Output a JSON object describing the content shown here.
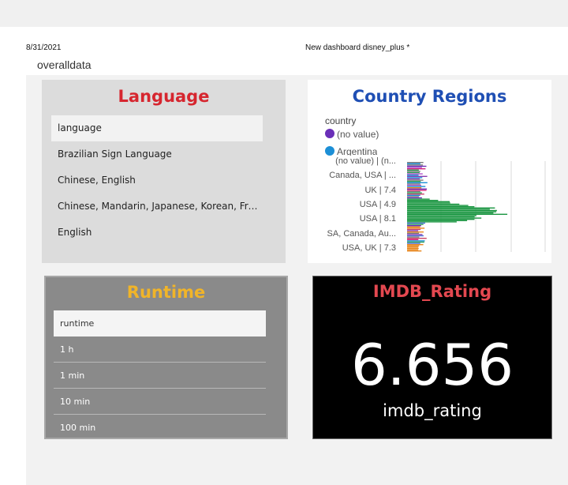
{
  "header": {
    "date": "8/31/2021",
    "dashboard_title": "New dashboard disney_plus *"
  },
  "sheet": {
    "name": "overalldata"
  },
  "colors": {
    "language_title": "#d6262f",
    "country_title": "#1f4fb4",
    "runtime_title": "#f0b429",
    "imdb_title": "#e34850",
    "bar_green": "#1a9641",
    "bar_orange": "#e8871e"
  },
  "language": {
    "title": "Language",
    "header": "language",
    "items": [
      "Brazilian Sign Language",
      "Chinese, English",
      "Chinese, Mandarin, Japanese, Korean, Fren...",
      "English"
    ]
  },
  "country": {
    "title": "Country Regions",
    "legend_title": "country",
    "legend": [
      {
        "label": "(no value)",
        "color": "#6a2fb8"
      },
      {
        "label": "Argentina",
        "color": "#1c8fd6"
      }
    ],
    "y_labels": [
      "(no value) | (n...",
      "Canada, USA | ...",
      "UK | 7.4",
      "USA | 4.9",
      "USA | 8.1",
      "SA, Canada, Au...",
      "USA, UK | 7.3"
    ]
  },
  "runtime": {
    "title": "Runtime",
    "header": "runtime",
    "items": [
      "1 h",
      "1 min",
      "10 min",
      "100 min"
    ]
  },
  "imdb": {
    "title": "IMDB_Rating",
    "value": "6.656",
    "label": "imdb_rating"
  }
}
